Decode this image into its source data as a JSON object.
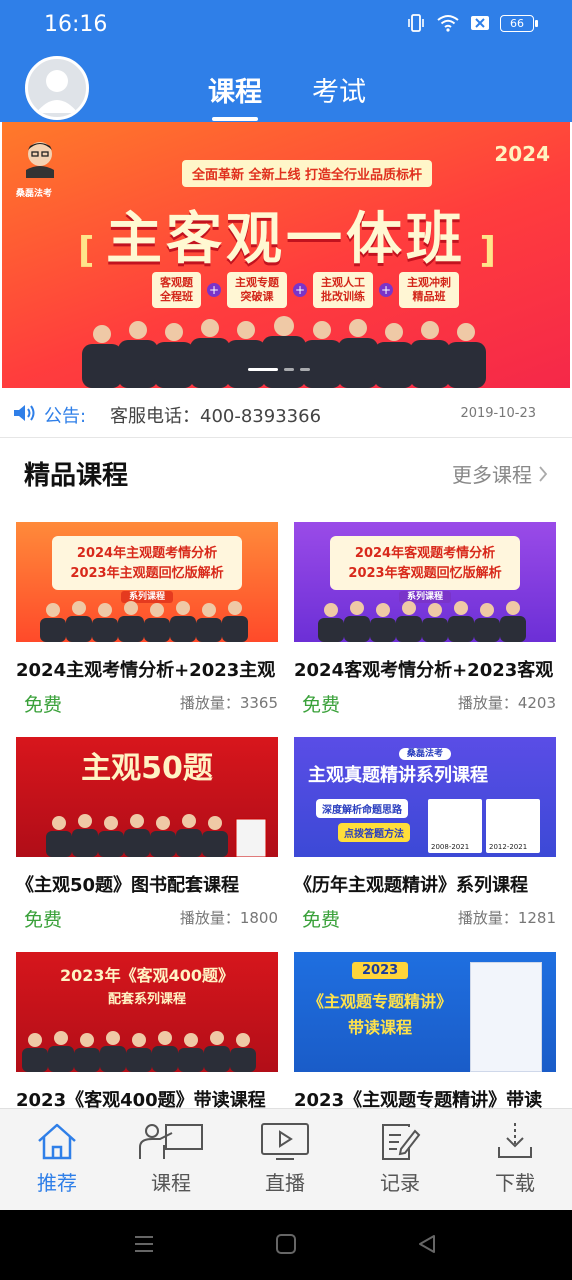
{
  "status_bar": {
    "time": "16:16",
    "battery": "66"
  },
  "header": {
    "tabs": [
      {
        "label": "课程",
        "active": true
      },
      {
        "label": "考试",
        "active": false
      }
    ]
  },
  "banner": {
    "year": "2024",
    "logo_text": "桑磊法考",
    "tagline": "全面革新  全新上线  打造全行业品质标杆",
    "title": "主客观一体班",
    "chips": [
      "客观题\n全程班",
      "主观专题\n突破课",
      "主观人工\n批改训练",
      "主观冲刺\n精品班"
    ]
  },
  "notice": {
    "label": "公告:",
    "text": "客服电话：400-8393366",
    "date": "2019-10-23"
  },
  "section": {
    "title": "精品课程",
    "more": "更多课程"
  },
  "courses": [
    {
      "title": "2024主观考情分析+2023主观",
      "price": "免费",
      "plays": "播放量：3365",
      "thumb_line1": "2024年主观题考情分析",
      "thumb_line2": "2023年主观题回忆版解析",
      "thumb_tag": "系列课程"
    },
    {
      "title": "2024客观考情分析+2023客观",
      "price": "免费",
      "plays": "播放量：4203",
      "thumb_line1": "2024年客观题考情分析",
      "thumb_line2": "2023年客观题回忆版解析",
      "thumb_tag": "系列课程"
    },
    {
      "title": "《主观50题》图书配套课程",
      "price": "免费",
      "plays": "播放量：1800",
      "thumb_line1": "主观50题"
    },
    {
      "title": "《历年主观题精讲》系列课程",
      "price": "免费",
      "plays": "播放量：1281",
      "thumb_logo": "桑磊法考",
      "thumb_line1": "主观真题精讲系列课程",
      "thumb_line2": "深度解析命题思路",
      "thumb_tag": "点拨答题方法",
      "book1": "2008-2021",
      "book2": "2012-2021"
    },
    {
      "title": "2023《客观400题》带读课程",
      "thumb_line1": "2023年《客观400题》",
      "thumb_line2": "配套系列课程"
    },
    {
      "title": "2023《主观题专题精讲》带读",
      "thumb_tag": "2023",
      "thumb_line1": "《主观题专题精讲》",
      "thumb_line2": "带读课程"
    }
  ],
  "bottom_nav": [
    {
      "label": "推荐",
      "icon": "home-icon",
      "active": true
    },
    {
      "label": "课程",
      "icon": "teacher-board-icon",
      "active": false
    },
    {
      "label": "直播",
      "icon": "live-tv-icon",
      "active": false
    },
    {
      "label": "记录",
      "icon": "record-edit-icon",
      "active": false
    },
    {
      "label": "下载",
      "icon": "download-icon",
      "active": false
    }
  ],
  "colors": {
    "primary": "#2f7fe8",
    "free_green": "#3aa13a"
  }
}
